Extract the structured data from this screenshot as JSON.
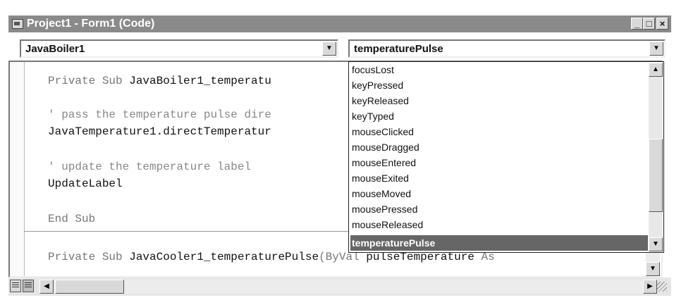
{
  "window": {
    "title": "Project1 - Form1 (Code)"
  },
  "combos": {
    "object_value": "JavaBoiler1",
    "procedure_value": "temperaturePulse"
  },
  "code_lines": {
    "l1_kw": "Private Sub ",
    "l1_name": "JavaBoiler1_temperatu",
    "l2": "' pass the temperature pulse dire",
    "l3": "JavaTemperature1.directTemperatur",
    "l4": "' update the temperature label",
    "l5": "UpdateLabel",
    "l6": "End Sub",
    "l7_kw": "Private Sub ",
    "l7_name": "JavaCooler1_temperaturePulse",
    "l7_rest_kw": "(ByVal ",
    "l7_rest_name": "pulseTemperature",
    "l7_tail_kw": " As"
  },
  "dropdown_items": [
    "focusLost",
    "keyPressed",
    "keyReleased",
    "keyTyped",
    "mouseClicked",
    "mouseDragged",
    "mouseEntered",
    "mouseExited",
    "mouseMoved",
    "mousePressed",
    "mouseReleased",
    "temperaturePulse"
  ],
  "selected_item": "temperaturePulse",
  "icons": [
    "app-icon",
    "minimize-icon",
    "maximize-icon",
    "close-icon",
    "chevron-down-icon",
    "scroll-up-icon",
    "scroll-down-icon",
    "scroll-left-icon",
    "scroll-right-icon",
    "procedure-view-icon",
    "full-module-view-icon",
    "resize-grip-icon"
  ]
}
